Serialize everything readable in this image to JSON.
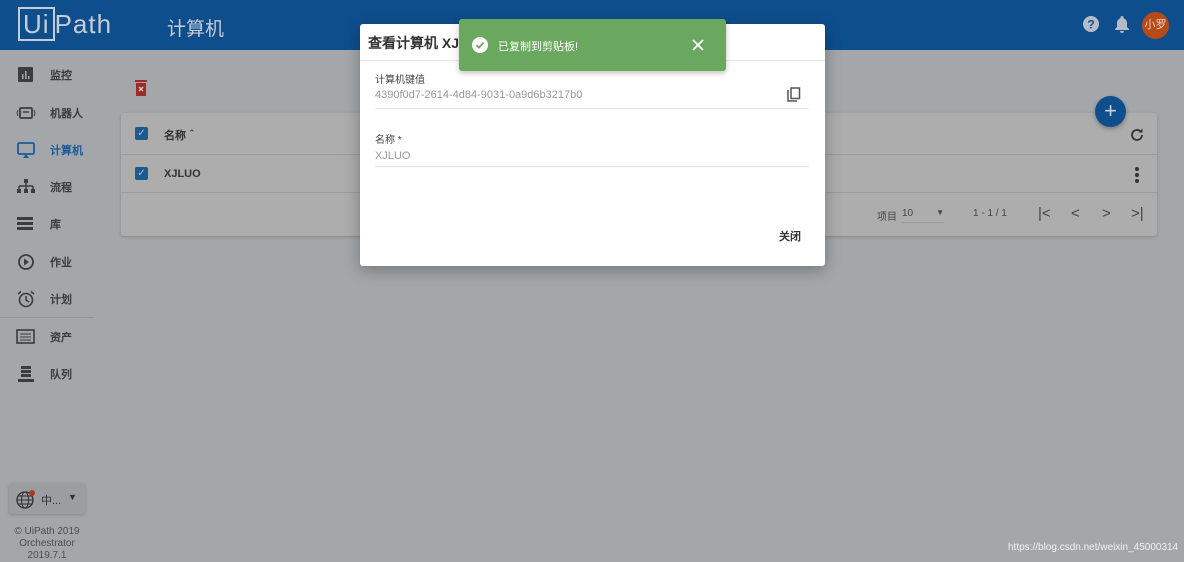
{
  "header": {
    "logo": "UiPath",
    "title": "计算机",
    "avatar": "小罗",
    "icons": [
      "help-icon",
      "bell-icon"
    ]
  },
  "sidebar": {
    "items": [
      {
        "label": "监控",
        "icon": "chart-icon"
      },
      {
        "label": "机器人",
        "icon": "robot-icon"
      },
      {
        "label": "计算机",
        "icon": "monitor-icon",
        "active": true
      },
      {
        "label": "流程",
        "icon": "sitemap-icon"
      },
      {
        "label": "库",
        "icon": "list-icon"
      },
      {
        "label": "作业",
        "icon": "play-icon"
      },
      {
        "label": "计划",
        "icon": "alarm-icon"
      },
      {
        "label": "资产",
        "icon": "asset-icon"
      },
      {
        "label": "队列",
        "icon": "queue-icon"
      }
    ],
    "language": "中...",
    "copyright": "© UiPath 2019",
    "version": "Orchestrator 2019.7.1"
  },
  "table": {
    "column": "名称",
    "rows": [
      {
        "name": "XJLUO",
        "checked": true
      }
    ],
    "pager": {
      "label": "项目",
      "page_size": "10",
      "range": "1 - 1 / 1"
    }
  },
  "dialog": {
    "title": "查看计算机 XJLUO",
    "key_label": "计算机键值",
    "key_value": "4390f0d7-2614-4d84-9031-0a9d6b3217b0",
    "name_label": "名称 *",
    "name_value": "XJLUO",
    "close": "关闭"
  },
  "toast": {
    "message": "已复制到剪贴板!",
    "color": "#6aa85f"
  },
  "watermark": "https://blog.csdn.net/weixin_45000314"
}
